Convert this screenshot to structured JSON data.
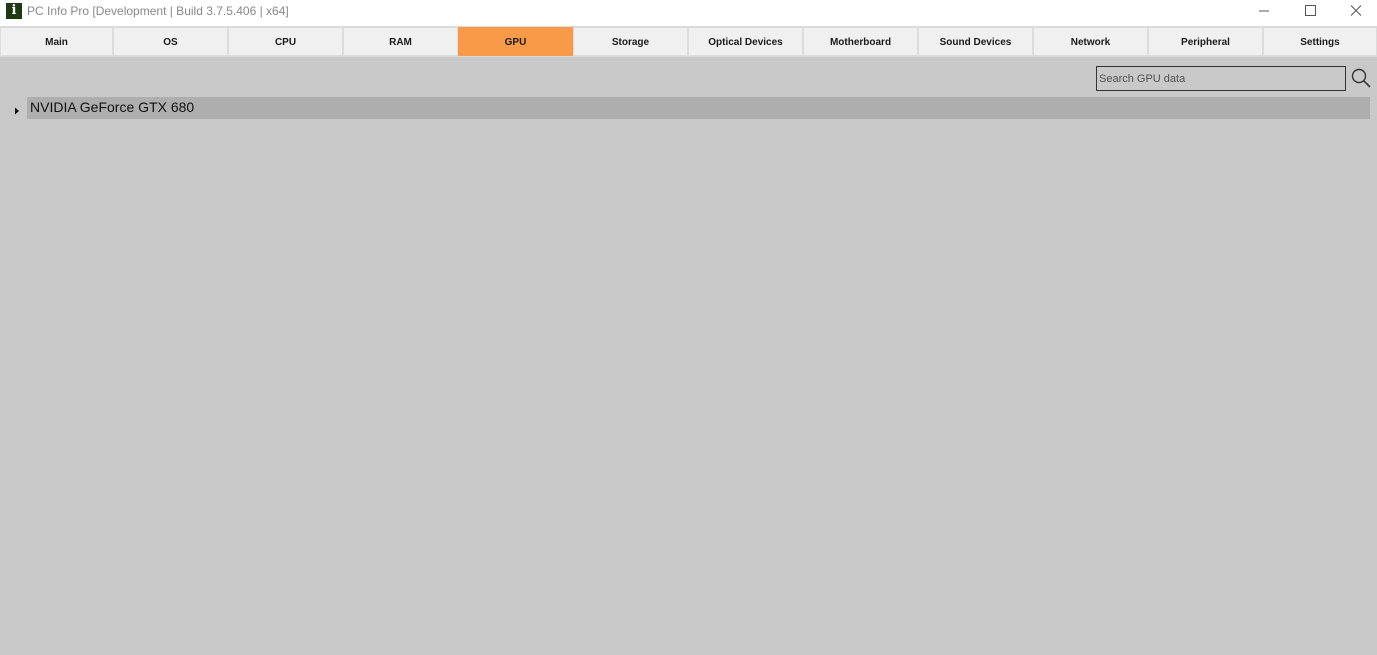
{
  "window": {
    "title": "PC Info Pro [Development | Build 3.7.5.406 | x64]",
    "app_icon_glyph": "i"
  },
  "tabs": [
    {
      "label": "Main"
    },
    {
      "label": "OS"
    },
    {
      "label": "CPU"
    },
    {
      "label": "RAM"
    },
    {
      "label": "GPU",
      "active": true
    },
    {
      "label": "Storage"
    },
    {
      "label": "Optical Devices"
    },
    {
      "label": "Motherboard"
    },
    {
      "label": "Sound Devices"
    },
    {
      "label": "Network"
    },
    {
      "label": "Peripheral"
    },
    {
      "label": "Settings"
    }
  ],
  "search": {
    "placeholder": "Search GPU data",
    "value": ""
  },
  "tree": {
    "items": [
      {
        "label": "NVIDIA GeForce GTX 680",
        "expanded": false
      }
    ]
  },
  "colors": {
    "active_tab": "#f99a48",
    "background": "#c9c9c9",
    "tree_row": "#aeaeae",
    "app_icon": "#1f3a13"
  },
  "icons": {
    "app": "info-icon",
    "minimize": "minimize-icon",
    "maximize": "maximize-icon",
    "close": "close-icon",
    "search": "search-icon",
    "expander": "triangle-right-icon"
  }
}
